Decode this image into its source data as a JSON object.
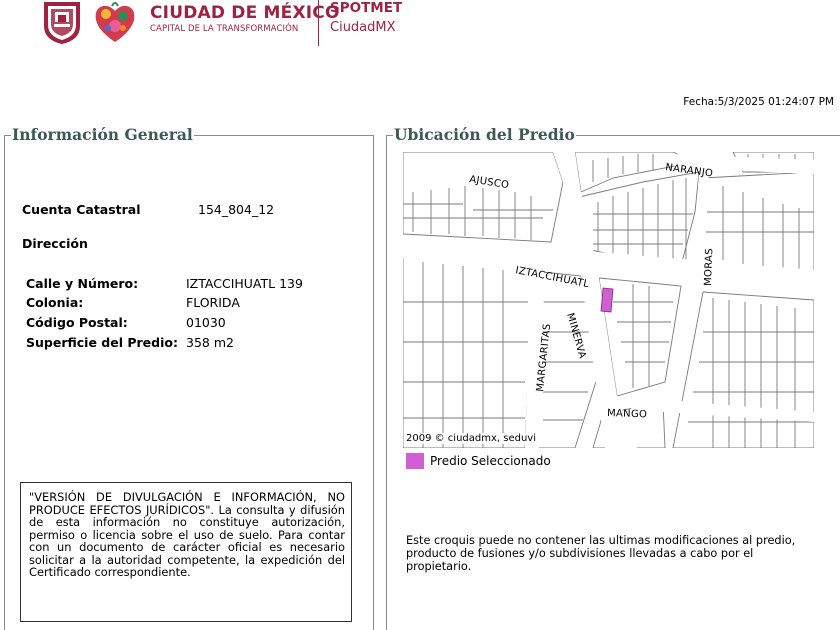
{
  "header": {
    "brand_title": "CIUDAD DE MÉXICO",
    "brand_subtitle": "CAPITAL DE LA TRANSFORMACIÓN",
    "app_title": "SPOTMET",
    "app_subtitle": "CiudadMX",
    "brand_color": "#9f2241"
  },
  "fecha": "Fecha:5/3/2025 01:24:07 PM",
  "info_general": {
    "legend": "Información General",
    "cuenta_label": "Cuenta Catastral",
    "cuenta_value": "154_804_12",
    "direccion_label": "Dirección",
    "calle_label": "Calle y Número:",
    "calle_value": "IZTACCIHUATL 139",
    "colonia_label": "Colonia:",
    "colonia_value": "FLORIDA",
    "cp_label": "Código Postal:",
    "cp_value": "01030",
    "superficie_label": "Superficie del Predio:",
    "superficie_value": "358 m2",
    "disclaimer": "\"VERSIÓN DE DIVULGACIÓN E INFORMACIÓN, NO PRODUCE EFECTOS JURÍDICOS\". La consulta y difusión de esta información no constituye autorización, permiso o licencia sobre el uso de suelo. Para contar con un documento de carácter oficial es necesario solicitar a la autoridad competente, la expedición del Certificado correspondiente."
  },
  "ubicacion": {
    "legend": "Ubicación del Predio",
    "streets": {
      "ajusco": "AJUSCO",
      "naranjo": "NARANJO",
      "moras": "MORAS",
      "iztaccihuatl": "IZTACCIHUATL",
      "margaritas": "MARGARITAS",
      "minerva": "MINERVA",
      "mango": "MANGO"
    },
    "attribution": "2009 © ciudadmx, seduvi",
    "legend_label": "Predio Seleccionado",
    "selected_color": "#d15fd3",
    "note": "Este croquis puede no contener las ultimas modificaciones al predio, producto de fusiones y/o subdivisiones llevadas a cabo por el propietario."
  }
}
